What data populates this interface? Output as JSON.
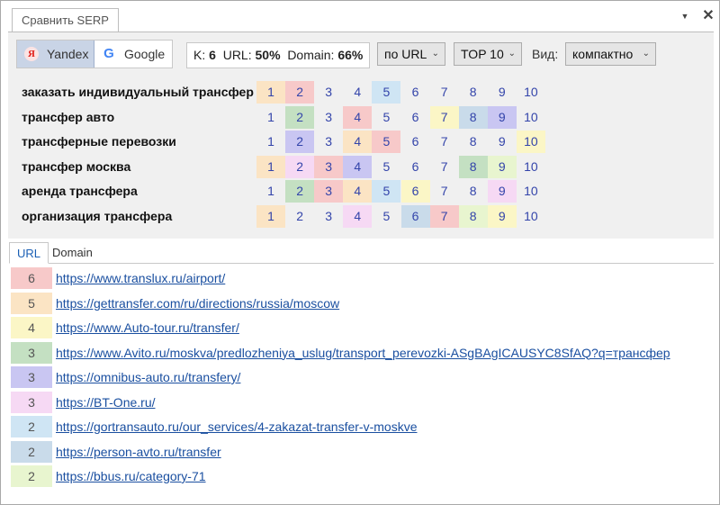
{
  "window": {
    "tab_title": "Сравнить SERP",
    "dropdown_icon": "chevron-down-icon",
    "close_icon": "close-icon"
  },
  "toolbar": {
    "engines": [
      {
        "label": "Yandex",
        "icon": "yandex-logo-icon",
        "active": true
      },
      {
        "label": "Google",
        "icon": "google-logo-icon",
        "active": false
      }
    ],
    "stats": {
      "k_label": "K:",
      "k_value": "6",
      "url_label": "URL:",
      "url_value": "50%",
      "domain_label": "Domain:",
      "domain_value": "66%"
    },
    "group_by": "по URL",
    "top": "TOP 10",
    "view_label": "Вид:",
    "view_value": "компактно"
  },
  "colors": {
    "red": "#f7c9c9",
    "orange": "#fbe4c4",
    "yellow": "#fbf6c6",
    "green": "#c4e0c2",
    "purple": "#c9c6f2",
    "pink": "#f6d9f4",
    "blue": "#cfe5f4",
    "blue2": "#c9dbea",
    "lime": "#e8f5cf",
    "link": "#1a4fa0"
  },
  "keywords": [
    {
      "label": "заказать индивидуальный трансфер",
      "cells": [
        {
          "n": "1",
          "c": "orange"
        },
        {
          "n": "2",
          "c": "red"
        },
        {
          "n": "3",
          "c": ""
        },
        {
          "n": "4",
          "c": ""
        },
        {
          "n": "5",
          "c": "blue"
        },
        {
          "n": "6",
          "c": ""
        },
        {
          "n": "7",
          "c": ""
        },
        {
          "n": "8",
          "c": ""
        },
        {
          "n": "9",
          "c": ""
        },
        {
          "n": "10",
          "c": ""
        }
      ]
    },
    {
      "label": "трансфер авто",
      "cells": [
        {
          "n": "1",
          "c": ""
        },
        {
          "n": "2",
          "c": "green"
        },
        {
          "n": "3",
          "c": ""
        },
        {
          "n": "4",
          "c": "red"
        },
        {
          "n": "5",
          "c": ""
        },
        {
          "n": "6",
          "c": ""
        },
        {
          "n": "7",
          "c": "yellow"
        },
        {
          "n": "8",
          "c": "blue2"
        },
        {
          "n": "9",
          "c": "purple"
        },
        {
          "n": "10",
          "c": ""
        }
      ]
    },
    {
      "label": "трансферные перевозки",
      "cells": [
        {
          "n": "1",
          "c": ""
        },
        {
          "n": "2",
          "c": "purple"
        },
        {
          "n": "3",
          "c": ""
        },
        {
          "n": "4",
          "c": "orange"
        },
        {
          "n": "5",
          "c": "red"
        },
        {
          "n": "6",
          "c": ""
        },
        {
          "n": "7",
          "c": ""
        },
        {
          "n": "8",
          "c": ""
        },
        {
          "n": "9",
          "c": ""
        },
        {
          "n": "10",
          "c": "yellow"
        }
      ]
    },
    {
      "label": "трансфер москва",
      "cells": [
        {
          "n": "1",
          "c": "orange"
        },
        {
          "n": "2",
          "c": "pink"
        },
        {
          "n": "3",
          "c": "red"
        },
        {
          "n": "4",
          "c": "purple"
        },
        {
          "n": "5",
          "c": ""
        },
        {
          "n": "6",
          "c": ""
        },
        {
          "n": "7",
          "c": ""
        },
        {
          "n": "8",
          "c": "green"
        },
        {
          "n": "9",
          "c": "lime"
        },
        {
          "n": "10",
          "c": ""
        }
      ]
    },
    {
      "label": "аренда трансфера",
      "cells": [
        {
          "n": "1",
          "c": ""
        },
        {
          "n": "2",
          "c": "green"
        },
        {
          "n": "3",
          "c": "red"
        },
        {
          "n": "4",
          "c": "orange"
        },
        {
          "n": "5",
          "c": "blue"
        },
        {
          "n": "6",
          "c": "yellow"
        },
        {
          "n": "7",
          "c": ""
        },
        {
          "n": "8",
          "c": ""
        },
        {
          "n": "9",
          "c": "pink"
        },
        {
          "n": "10",
          "c": ""
        }
      ]
    },
    {
      "label": "организация трансфера",
      "cells": [
        {
          "n": "1",
          "c": "orange"
        },
        {
          "n": "2",
          "c": ""
        },
        {
          "n": "3",
          "c": ""
        },
        {
          "n": "4",
          "c": "pink"
        },
        {
          "n": "5",
          "c": ""
        },
        {
          "n": "6",
          "c": "blue2"
        },
        {
          "n": "7",
          "c": "red"
        },
        {
          "n": "8",
          "c": "lime"
        },
        {
          "n": "9",
          "c": "yellow"
        },
        {
          "n": "10",
          "c": ""
        }
      ]
    }
  ],
  "tabs": [
    {
      "label": "URL",
      "active": true
    },
    {
      "label": "Domain",
      "active": false
    }
  ],
  "urls": [
    {
      "count": "6",
      "c": "red",
      "url": "https://www.translux.ru/airport/"
    },
    {
      "count": "5",
      "c": "orange",
      "url": "https://gettransfer.com/ru/directions/russia/moscow"
    },
    {
      "count": "4",
      "c": "yellow",
      "url": "https://www.Auto-tour.ru/transfer/"
    },
    {
      "count": "3",
      "c": "green",
      "url": "https://www.Avito.ru/moskva/predlozheniya_uslug/transport_perevozki-ASgBAgICAUSYC8SfAQ?q=трансфер"
    },
    {
      "count": "3",
      "c": "purple",
      "url": "https://omnibus-auto.ru/transfery/"
    },
    {
      "count": "3",
      "c": "pink",
      "url": "https://BT-One.ru/"
    },
    {
      "count": "2",
      "c": "blue",
      "url": "https://gortransauto.ru/our_services/4-zakazat-transfer-v-moskve"
    },
    {
      "count": "2",
      "c": "blue2",
      "url": "https://person-avto.ru/transfer"
    },
    {
      "count": "2",
      "c": "lime",
      "url": "https://bbus.ru/category-71"
    }
  ]
}
